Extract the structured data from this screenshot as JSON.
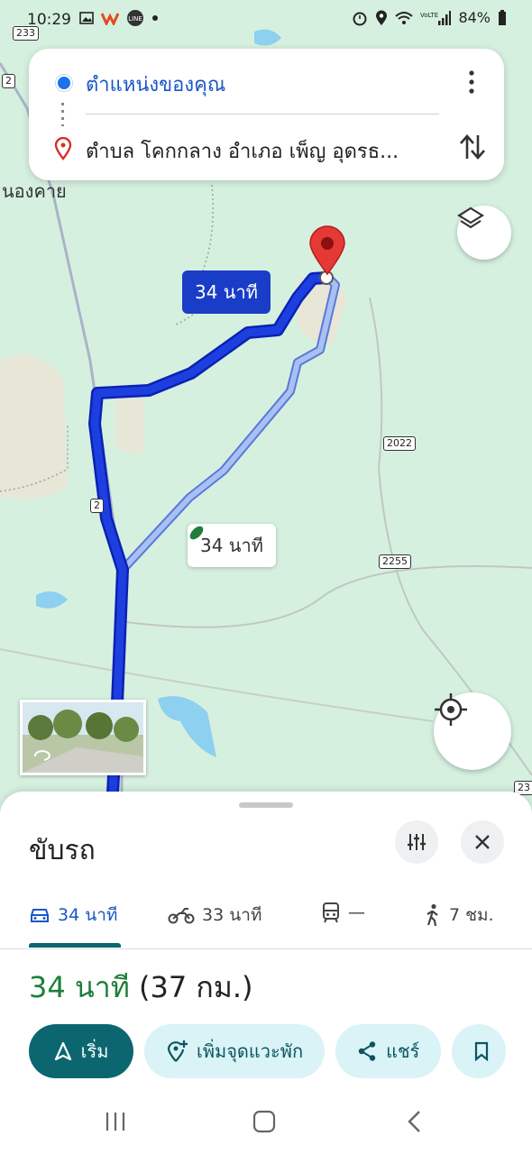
{
  "status_bar": {
    "time": "10:29",
    "battery": "84%"
  },
  "route_card": {
    "origin": "ตำแหน่งของคุณ",
    "destination": "ตำบล โคกกลาง อำเภอ เพ็ญ อุดรธ..."
  },
  "map": {
    "place_label": "นองคาย",
    "eta_primary": "34 นาที",
    "eta_alternate": "34 นาที",
    "road_shields": [
      "233",
      "2",
      "2",
      "2022",
      "2255",
      "23"
    ]
  },
  "sheet": {
    "title": "ขับรถ",
    "modes": [
      {
        "icon": "car-icon",
        "label": "34 นาที"
      },
      {
        "icon": "motorcycle-icon",
        "label": "33 นาที"
      },
      {
        "icon": "transit-icon",
        "label": "—"
      },
      {
        "icon": "walk-icon",
        "label": "7 ชม."
      }
    ],
    "summary_time": "34 นาที",
    "summary_distance": "(37 กม.)",
    "actions": {
      "start": "เริ่ม",
      "add_stop": "เพิ่มจุดแวะพัก",
      "share": "แชร์"
    }
  },
  "colors": {
    "map_bg": "#d6f0e0",
    "route_primary": "#1a3dc8",
    "route_alt": "#9bb4f0",
    "accent_teal": "#0b6670",
    "time_green": "#1e7e3a"
  }
}
